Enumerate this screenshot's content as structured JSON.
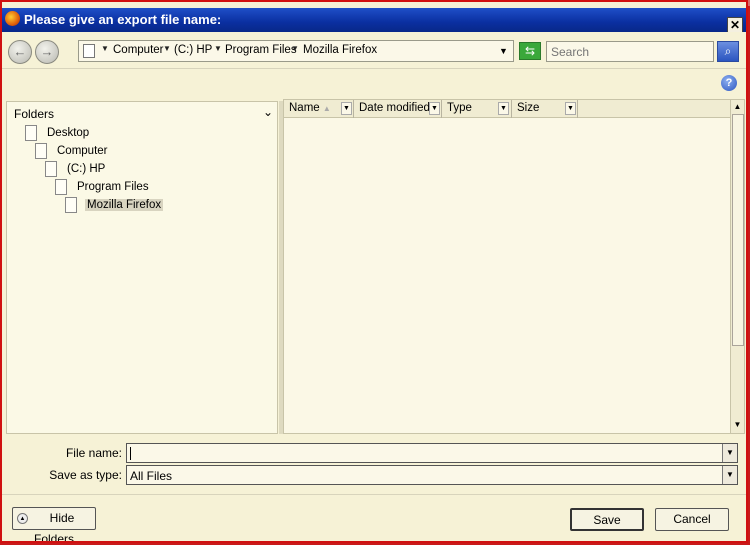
{
  "window": {
    "title": "Please give an export file name:",
    "close_glyph": "✕"
  },
  "toolbar": {
    "back_glyph": "←",
    "forward_glyph": "→",
    "breadcrumb": [
      "Computer",
      "(C:) HP",
      "Program Files",
      "Mozilla Firefox"
    ],
    "refresh_glyph": "⇆",
    "search_placeholder": "Search",
    "search_glyph": "⌕",
    "help_glyph": "?"
  },
  "folders": {
    "header": "Folders",
    "tree": [
      {
        "label": "Desktop",
        "level": 0
      },
      {
        "label": "Computer",
        "level": 1
      },
      {
        "label": "(C:) HP",
        "level": 2
      },
      {
        "label": "Program Files",
        "level": 3
      },
      {
        "label": "Mozilla Firefox",
        "level": 4,
        "selected": true
      }
    ]
  },
  "file_list": {
    "columns": [
      "Name",
      "Date modified",
      "Type",
      "Size"
    ]
  },
  "form": {
    "file_name_label": "File name:",
    "file_name_value": "",
    "save_type_label": "Save as type:",
    "save_type_value": "All Files"
  },
  "buttons": {
    "hide_folders": "Hide Folders",
    "save": "Save",
    "cancel": "Cancel"
  },
  "colors": {
    "titlebar": "#0a2fa0",
    "window_bg": "#f6f2d6",
    "border": "#d01010"
  }
}
